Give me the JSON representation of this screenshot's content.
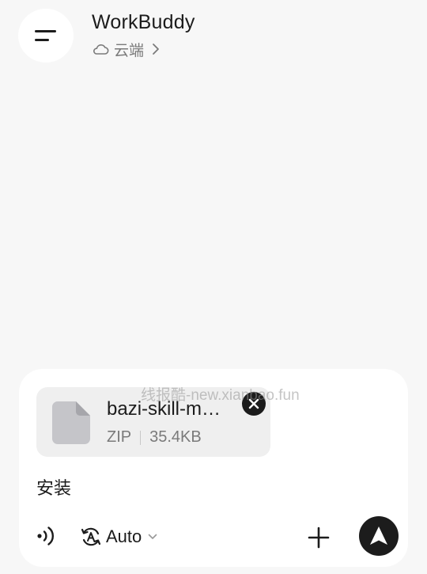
{
  "header": {
    "menu_icon": "menu-icon",
    "title": "WorkBuddy",
    "subtitle": "云端",
    "subtitle_icon": "cloud-icon",
    "subtitle_chevron": "chevron-right-icon"
  },
  "composer": {
    "attachment": {
      "icon": "file-icon",
      "name": "bazi-skill-m…",
      "type": "ZIP",
      "size": "35.4KB",
      "remove_icon": "close-icon"
    },
    "message": "安装",
    "toolbar": {
      "voice_icon": "voice-icon",
      "model_icon": "auto-mode-icon",
      "model_label": "Auto",
      "add_icon": "plus-icon",
      "send_icon": "send-icon"
    }
  },
  "watermark": "线报酷-new.xianbao.fun",
  "colors": {
    "background": "#f7f7f7",
    "panel": "#ffffff",
    "attachment_bg": "#efefef",
    "primary_dark": "#1c1c1c",
    "muted_text": "#7a7a7a"
  }
}
